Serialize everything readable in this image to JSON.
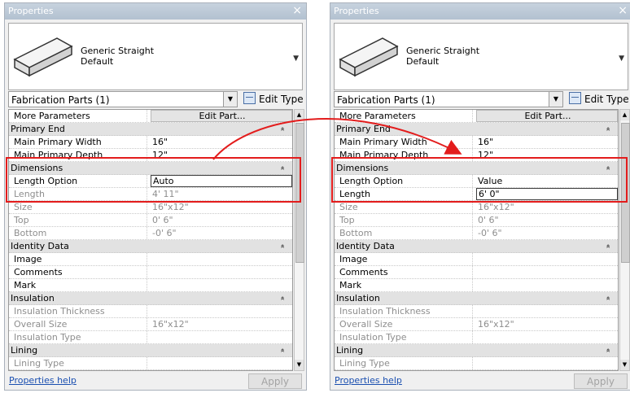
{
  "colors": {
    "highlight": "#e31c1c",
    "link": "#1a4fb0",
    "title_bar": "#b9c6d4"
  },
  "icons": {
    "close": "close-icon",
    "edit_type": "edit-type-icon",
    "dropdown": "chevron-down-icon",
    "collapse": "collapse-icon",
    "preview": "duct-preview-icon"
  },
  "left": {
    "title": "Properties",
    "close": "×",
    "type_name_1": "Generic Straight",
    "type_name_2": "Default",
    "selector": "Fabrication Parts (1)",
    "edit_type": "Edit Type",
    "rows": [
      {
        "kind": "btn",
        "k": "More Parameters",
        "v": "Edit Part..."
      },
      {
        "kind": "grp",
        "k": "Primary End"
      },
      {
        "kind": "p",
        "k": "Main Primary Width",
        "v": "16\""
      },
      {
        "kind": "p",
        "k": "Main Primary Depth",
        "v": "12\""
      },
      {
        "kind": "grp",
        "k": "Dimensions"
      },
      {
        "kind": "edit",
        "k": "Length Option",
        "v": "Auto"
      },
      {
        "kind": "ro",
        "k": "Length",
        "v": "4'  11\""
      },
      {
        "kind": "ro",
        "k": "Size",
        "v": "16\"x12\""
      },
      {
        "kind": "ro",
        "k": "Top",
        "v": "0'  6\""
      },
      {
        "kind": "ro",
        "k": "Bottom",
        "v": "-0'  6\""
      },
      {
        "kind": "grp",
        "k": "Identity Data"
      },
      {
        "kind": "p",
        "k": "Image",
        "v": ""
      },
      {
        "kind": "p",
        "k": "Comments",
        "v": ""
      },
      {
        "kind": "p",
        "k": "Mark",
        "v": ""
      },
      {
        "kind": "grp",
        "k": "Insulation"
      },
      {
        "kind": "ro",
        "k": "Insulation Thickness",
        "v": ""
      },
      {
        "kind": "ro",
        "k": "Overall Size",
        "v": "16\"x12\""
      },
      {
        "kind": "ro",
        "k": "Insulation Type",
        "v": ""
      },
      {
        "kind": "grp",
        "k": "Lining"
      },
      {
        "kind": "ro",
        "k": "Lining Type",
        "v": ""
      }
    ],
    "help": "Properties help",
    "apply": "Apply"
  },
  "right": {
    "title": "Properties",
    "close": "×",
    "type_name_1": "Generic Straight",
    "type_name_2": "Default",
    "selector": "Fabrication Parts (1)",
    "edit_type": "Edit Type",
    "rows": [
      {
        "kind": "btn",
        "k": "More Parameters",
        "v": "Edit Part..."
      },
      {
        "kind": "grp",
        "k": "Primary End"
      },
      {
        "kind": "p",
        "k": "Main Primary Width",
        "v": "16\""
      },
      {
        "kind": "p",
        "k": "Main Primary Depth",
        "v": "12\""
      },
      {
        "kind": "grp",
        "k": "Dimensions"
      },
      {
        "kind": "p",
        "k": "Length Option",
        "v": "Value"
      },
      {
        "kind": "edit",
        "k": "Length",
        "v": "6'  0\""
      },
      {
        "kind": "ro",
        "k": "Size",
        "v": "16\"x12\""
      },
      {
        "kind": "ro",
        "k": "Top",
        "v": "0'  6\""
      },
      {
        "kind": "ro",
        "k": "Bottom",
        "v": "-0'  6\""
      },
      {
        "kind": "grp",
        "k": "Identity Data"
      },
      {
        "kind": "p",
        "k": "Image",
        "v": ""
      },
      {
        "kind": "p",
        "k": "Comments",
        "v": ""
      },
      {
        "kind": "p",
        "k": "Mark",
        "v": ""
      },
      {
        "kind": "grp",
        "k": "Insulation"
      },
      {
        "kind": "ro",
        "k": "Insulation Thickness",
        "v": ""
      },
      {
        "kind": "ro",
        "k": "Overall Size",
        "v": "16\"x12\""
      },
      {
        "kind": "ro",
        "k": "Insulation Type",
        "v": ""
      },
      {
        "kind": "grp",
        "k": "Lining"
      },
      {
        "kind": "ro",
        "k": "Lining Type",
        "v": ""
      }
    ],
    "help": "Properties help",
    "apply": "Apply"
  }
}
